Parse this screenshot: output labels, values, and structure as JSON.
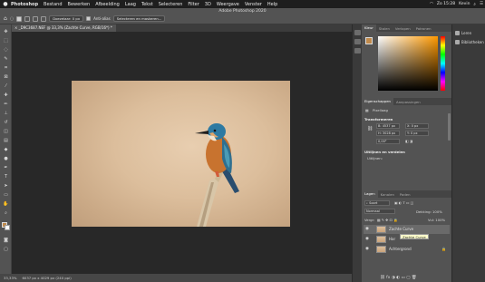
{
  "menubar": {
    "apple": "",
    "app": "Photoshop",
    "items": [
      "Bestand",
      "Bewerken",
      "Afbeelding",
      "Laag",
      "Tekst",
      "Selecteren",
      "Filter",
      "3D",
      "Weergave",
      "Venster",
      "Help"
    ],
    "clock": "Zo 15:28",
    "user": "Kevin"
  },
  "window": {
    "title": "Adobe Photoshop 2020"
  },
  "options": {
    "feather": "Doezelaar: 0 px",
    "antialias": "Anti-alias",
    "select_mask": "Selecteren en maskeren..."
  },
  "document": {
    "tab": "_D9C3687.NEF @ 33,3% (Zachte Curve, RGB/16*) *"
  },
  "status": {
    "zoom": "33,33%",
    "size": "6037 px x 4029 px (240 ppi)"
  },
  "color_panel": {
    "tabs": [
      "Kleur",
      "Stalen",
      "Verlopen",
      "Patronen"
    ]
  },
  "props_panel": {
    "tabs": [
      "Eigenschappen",
      "Aanpassingen"
    ],
    "kind": "Pixellaag",
    "transform_label": "Transformeren",
    "w": "B: 4537 px",
    "h": "H: 3028 px",
    "x": "X: 0 px",
    "y": "Y: 0 px",
    "angle": "0,00°",
    "align_label": "Uitlijnen en verdelen",
    "align_sub": "Uitlijnen:"
  },
  "layers_panel": {
    "tabs": [
      "Lagen",
      "Kanalen",
      "Paden"
    ],
    "kind": "Soort",
    "blend": "Normaal",
    "opacity": "Dekking: 100%",
    "lock": "Vergr:",
    "fill": "Vul: 100%",
    "layers": [
      {
        "name": "Zachte Curve",
        "selected": true
      },
      {
        "name": "Har",
        "selected": false
      },
      {
        "name": "Achtergrond",
        "selected": false
      }
    ],
    "tooltip": "Zachte Curve"
  },
  "far_right": {
    "items": [
      "Leren",
      "Bibliotheken"
    ]
  },
  "colors": {
    "foreground": "#c08a4c",
    "background": "#ffffff",
    "panel": "#535353"
  }
}
